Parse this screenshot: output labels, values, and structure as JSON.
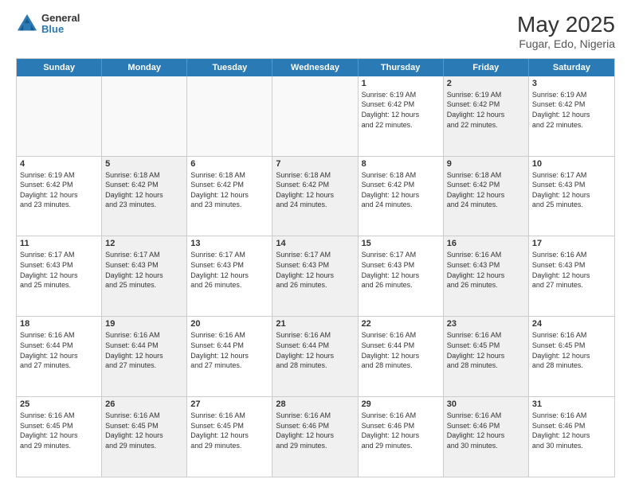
{
  "header": {
    "logo_line1": "General",
    "logo_line2": "Blue",
    "title": "May 2025",
    "subtitle": "Fugar, Edo, Nigeria"
  },
  "days": [
    "Sunday",
    "Monday",
    "Tuesday",
    "Wednesday",
    "Thursday",
    "Friday",
    "Saturday"
  ],
  "weeks": [
    [
      {
        "day": "",
        "text": "",
        "shaded": false,
        "empty": true
      },
      {
        "day": "",
        "text": "",
        "shaded": false,
        "empty": true
      },
      {
        "day": "",
        "text": "",
        "shaded": false,
        "empty": true
      },
      {
        "day": "",
        "text": "",
        "shaded": false,
        "empty": true
      },
      {
        "day": "1",
        "text": "Sunrise: 6:19 AM\nSunset: 6:42 PM\nDaylight: 12 hours\nand 22 minutes.",
        "shaded": false,
        "empty": false
      },
      {
        "day": "2",
        "text": "Sunrise: 6:19 AM\nSunset: 6:42 PM\nDaylight: 12 hours\nand 22 minutes.",
        "shaded": true,
        "empty": false
      },
      {
        "day": "3",
        "text": "Sunrise: 6:19 AM\nSunset: 6:42 PM\nDaylight: 12 hours\nand 22 minutes.",
        "shaded": false,
        "empty": false
      }
    ],
    [
      {
        "day": "4",
        "text": "Sunrise: 6:19 AM\nSunset: 6:42 PM\nDaylight: 12 hours\nand 23 minutes.",
        "shaded": false,
        "empty": false
      },
      {
        "day": "5",
        "text": "Sunrise: 6:18 AM\nSunset: 6:42 PM\nDaylight: 12 hours\nand 23 minutes.",
        "shaded": true,
        "empty": false
      },
      {
        "day": "6",
        "text": "Sunrise: 6:18 AM\nSunset: 6:42 PM\nDaylight: 12 hours\nand 23 minutes.",
        "shaded": false,
        "empty": false
      },
      {
        "day": "7",
        "text": "Sunrise: 6:18 AM\nSunset: 6:42 PM\nDaylight: 12 hours\nand 24 minutes.",
        "shaded": true,
        "empty": false
      },
      {
        "day": "8",
        "text": "Sunrise: 6:18 AM\nSunset: 6:42 PM\nDaylight: 12 hours\nand 24 minutes.",
        "shaded": false,
        "empty": false
      },
      {
        "day": "9",
        "text": "Sunrise: 6:18 AM\nSunset: 6:42 PM\nDaylight: 12 hours\nand 24 minutes.",
        "shaded": true,
        "empty": false
      },
      {
        "day": "10",
        "text": "Sunrise: 6:17 AM\nSunset: 6:43 PM\nDaylight: 12 hours\nand 25 minutes.",
        "shaded": false,
        "empty": false
      }
    ],
    [
      {
        "day": "11",
        "text": "Sunrise: 6:17 AM\nSunset: 6:43 PM\nDaylight: 12 hours\nand 25 minutes.",
        "shaded": false,
        "empty": false
      },
      {
        "day": "12",
        "text": "Sunrise: 6:17 AM\nSunset: 6:43 PM\nDaylight: 12 hours\nand 25 minutes.",
        "shaded": true,
        "empty": false
      },
      {
        "day": "13",
        "text": "Sunrise: 6:17 AM\nSunset: 6:43 PM\nDaylight: 12 hours\nand 26 minutes.",
        "shaded": false,
        "empty": false
      },
      {
        "day": "14",
        "text": "Sunrise: 6:17 AM\nSunset: 6:43 PM\nDaylight: 12 hours\nand 26 minutes.",
        "shaded": true,
        "empty": false
      },
      {
        "day": "15",
        "text": "Sunrise: 6:17 AM\nSunset: 6:43 PM\nDaylight: 12 hours\nand 26 minutes.",
        "shaded": false,
        "empty": false
      },
      {
        "day": "16",
        "text": "Sunrise: 6:16 AM\nSunset: 6:43 PM\nDaylight: 12 hours\nand 26 minutes.",
        "shaded": true,
        "empty": false
      },
      {
        "day": "17",
        "text": "Sunrise: 6:16 AM\nSunset: 6:43 PM\nDaylight: 12 hours\nand 27 minutes.",
        "shaded": false,
        "empty": false
      }
    ],
    [
      {
        "day": "18",
        "text": "Sunrise: 6:16 AM\nSunset: 6:44 PM\nDaylight: 12 hours\nand 27 minutes.",
        "shaded": false,
        "empty": false
      },
      {
        "day": "19",
        "text": "Sunrise: 6:16 AM\nSunset: 6:44 PM\nDaylight: 12 hours\nand 27 minutes.",
        "shaded": true,
        "empty": false
      },
      {
        "day": "20",
        "text": "Sunrise: 6:16 AM\nSunset: 6:44 PM\nDaylight: 12 hours\nand 27 minutes.",
        "shaded": false,
        "empty": false
      },
      {
        "day": "21",
        "text": "Sunrise: 6:16 AM\nSunset: 6:44 PM\nDaylight: 12 hours\nand 28 minutes.",
        "shaded": true,
        "empty": false
      },
      {
        "day": "22",
        "text": "Sunrise: 6:16 AM\nSunset: 6:44 PM\nDaylight: 12 hours\nand 28 minutes.",
        "shaded": false,
        "empty": false
      },
      {
        "day": "23",
        "text": "Sunrise: 6:16 AM\nSunset: 6:45 PM\nDaylight: 12 hours\nand 28 minutes.",
        "shaded": true,
        "empty": false
      },
      {
        "day": "24",
        "text": "Sunrise: 6:16 AM\nSunset: 6:45 PM\nDaylight: 12 hours\nand 28 minutes.",
        "shaded": false,
        "empty": false
      }
    ],
    [
      {
        "day": "25",
        "text": "Sunrise: 6:16 AM\nSunset: 6:45 PM\nDaylight: 12 hours\nand 29 minutes.",
        "shaded": false,
        "empty": false
      },
      {
        "day": "26",
        "text": "Sunrise: 6:16 AM\nSunset: 6:45 PM\nDaylight: 12 hours\nand 29 minutes.",
        "shaded": true,
        "empty": false
      },
      {
        "day": "27",
        "text": "Sunrise: 6:16 AM\nSunset: 6:45 PM\nDaylight: 12 hours\nand 29 minutes.",
        "shaded": false,
        "empty": false
      },
      {
        "day": "28",
        "text": "Sunrise: 6:16 AM\nSunset: 6:46 PM\nDaylight: 12 hours\nand 29 minutes.",
        "shaded": true,
        "empty": false
      },
      {
        "day": "29",
        "text": "Sunrise: 6:16 AM\nSunset: 6:46 PM\nDaylight: 12 hours\nand 29 minutes.",
        "shaded": false,
        "empty": false
      },
      {
        "day": "30",
        "text": "Sunrise: 6:16 AM\nSunset: 6:46 PM\nDaylight: 12 hours\nand 30 minutes.",
        "shaded": true,
        "empty": false
      },
      {
        "day": "31",
        "text": "Sunrise: 6:16 AM\nSunset: 6:46 PM\nDaylight: 12 hours\nand 30 minutes.",
        "shaded": false,
        "empty": false
      }
    ]
  ]
}
